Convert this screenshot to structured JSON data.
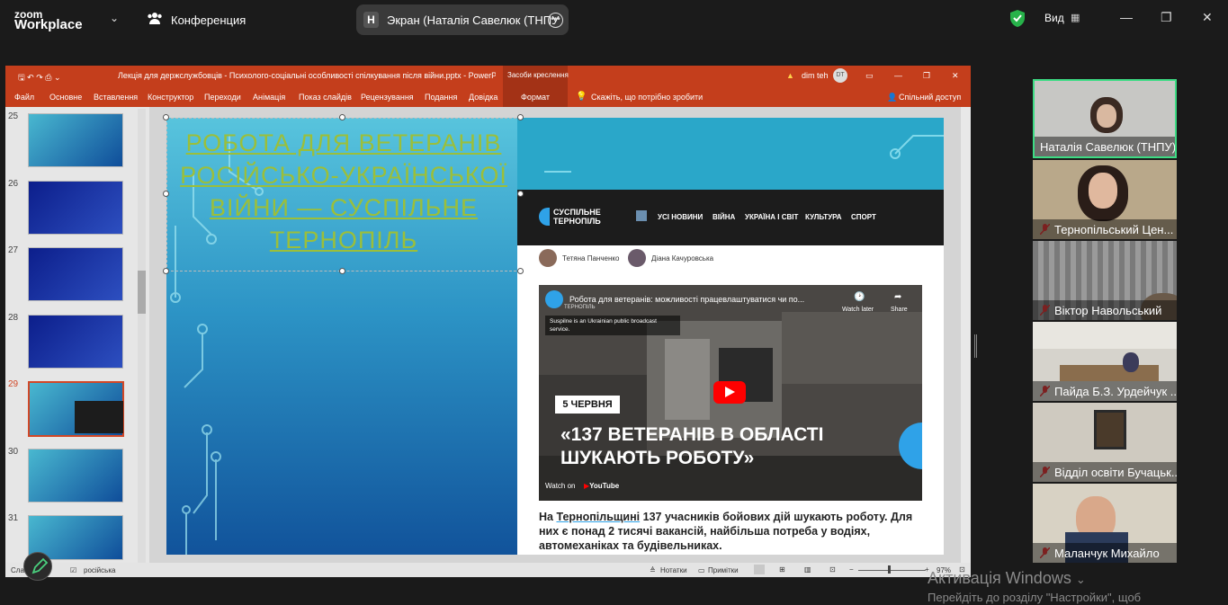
{
  "zoom": {
    "logo_line1": "zoom",
    "logo_line2": "Workplace",
    "conference": "Конференция",
    "screen_letter": "Н",
    "screen_label": "Экран (Наталія Савелюк (ТНПУ",
    "view_label": "Вид"
  },
  "ppt": {
    "title": "Лекція для держслужбовців - Психолого-соціальні особливості спілкування після війни.pptx - PowerPoint",
    "tools_context": "Засоби креслення",
    "user": "dim teh",
    "user_initials": "DT",
    "tabs": [
      "Файл",
      "Основне",
      "Вставлення",
      "Конструктор",
      "Переходи",
      "Анімація",
      "Показ слайдів",
      "Рецензування",
      "Подання",
      "Довідка",
      "Формат"
    ],
    "tell_me": "Скажіть, що потрібно зробити",
    "share": "Спільний доступ",
    "slide_numbers": [
      "25",
      "26",
      "27",
      "28",
      "29",
      "30",
      "31"
    ],
    "selected_slide": "29",
    "status_slide": "Слай",
    "status_lang": "російська",
    "notes": "Нотатки",
    "comments": "Примітки",
    "zoom_pct": "97%"
  },
  "slide": {
    "title": "РОБОТА ДЛЯ ВЕТЕРАНІВ РОСІЙСЬКО-УКРАЇНСЬКОЇ ВІЙНИ — СУСПІЛЬНЕ ТЕРНОПІЛЬ",
    "site_logo_line1": "СУСПІЛЬНЕ",
    "site_logo_line2": "ТЕРНОПІЛЬ",
    "nav": [
      "УСІ НОВИНИ",
      "ВІЙНА",
      "УКРАЇНА І СВІТ",
      "КУЛЬТУРА",
      "СПОРТ"
    ],
    "authors": [
      "Тетяна Панченко",
      "Діана Качуровська"
    ],
    "video_title": "Робота для ветеранів: можливості працевлаштуватися чи по...",
    "video_channel": "ТЕРНОПІЛЬ",
    "watch_later": "Watch later",
    "share": "Share",
    "suspilne_note": "Suspilne is an Ukrainian public broadcast service.",
    "date_badge": "5 ЧЕРВНЯ",
    "big_line1": "«137 ВЕТЕРАНІВ В ОБЛАСТІ",
    "big_line2": "ШУКАЮТЬ РОБОТУ»",
    "watch_on": "Watch on",
    "youtube": "YouTube",
    "article_prefix": "На ",
    "article_link": "Тернопільщині",
    "article_rest": " 137 учасників бойових дій шукають роботу. Для них є понад 2 тисячі вакансій, найбільша потреба у водіях, автомеханіках та будівельниках."
  },
  "participants": [
    {
      "name": "Наталія Савелюк (ТНПУ)",
      "muted": false
    },
    {
      "name": "Тернопільський Цен...",
      "muted": true
    },
    {
      "name": "Віктор Навольський",
      "muted": true
    },
    {
      "name": "Пайда Б.З. Урдейчук ...",
      "muted": true
    },
    {
      "name": "Відділ освіти Бучацьк...",
      "muted": true
    },
    {
      "name": "Маланчук Михайло",
      "muted": true
    }
  ],
  "watermark": {
    "line1": "Активація Windows",
    "line2": "Перейдіть до розділу \"Настройки\", щоб"
  },
  "colors": {
    "ppt_red": "#c43e1c",
    "active_speaker": "#3ddc84",
    "slide_title": "#9bbf3a"
  }
}
